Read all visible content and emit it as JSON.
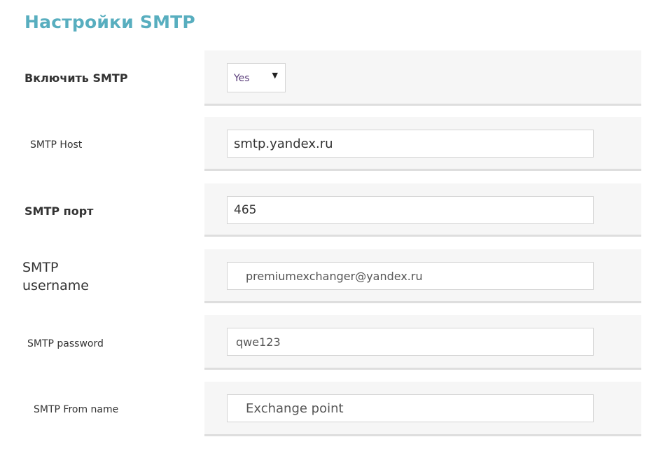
{
  "page": {
    "title": "Настройки SMTP"
  },
  "form": {
    "enable_smtp": {
      "label": "Включить SMTP",
      "selected": "Yes",
      "arrow_icon": "triangle-down"
    },
    "smtp_host": {
      "label": "SMTP Host",
      "value": "smtp.yandex.ru"
    },
    "smtp_port": {
      "label": "SMTP порт",
      "value": "465"
    },
    "smtp_username": {
      "label": "SMTP username",
      "value": "premiumexchanger@yandex.ru"
    },
    "smtp_password": {
      "label": "SMTP password",
      "value": "qwe123"
    },
    "smtp_from_name": {
      "label": "SMTP From name",
      "value": "Exchange point"
    }
  },
  "colors": {
    "title": "#58aebf",
    "panel_bg": "#f6f6f6",
    "panel_border": "#dedede",
    "select_value": "#5a3d7a"
  }
}
